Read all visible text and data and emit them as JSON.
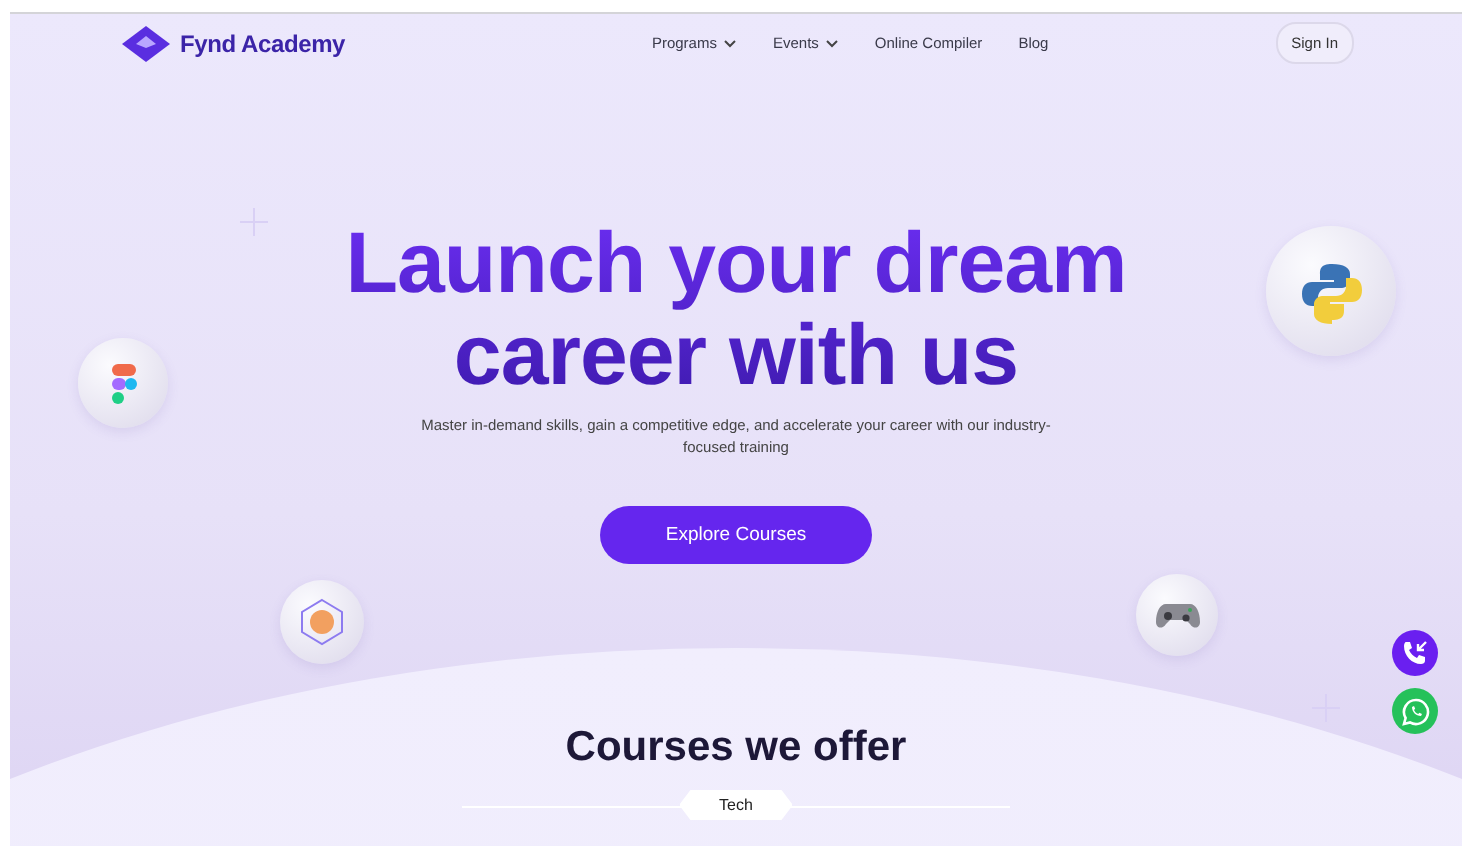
{
  "header": {
    "brand": "Fynd Academy",
    "nav": [
      {
        "label": "Programs",
        "kind": "dropdown"
      },
      {
        "label": "Events",
        "kind": "dropdown"
      },
      {
        "label": "Online Compiler",
        "kind": "link"
      },
      {
        "label": "Blog",
        "kind": "link"
      }
    ],
    "sign_in": "Sign In"
  },
  "hero": {
    "title_lines": [
      "Launch your dream",
      "career with us"
    ],
    "subtitle": "Master in-demand skills, gain a competitive edge, and accelerate your career with our industry-focused training",
    "cta": "Explore Courses"
  },
  "courses": {
    "heading": "Courses we offer",
    "tabs": [
      {
        "label": "Tech",
        "selected": true
      }
    ]
  }
}
